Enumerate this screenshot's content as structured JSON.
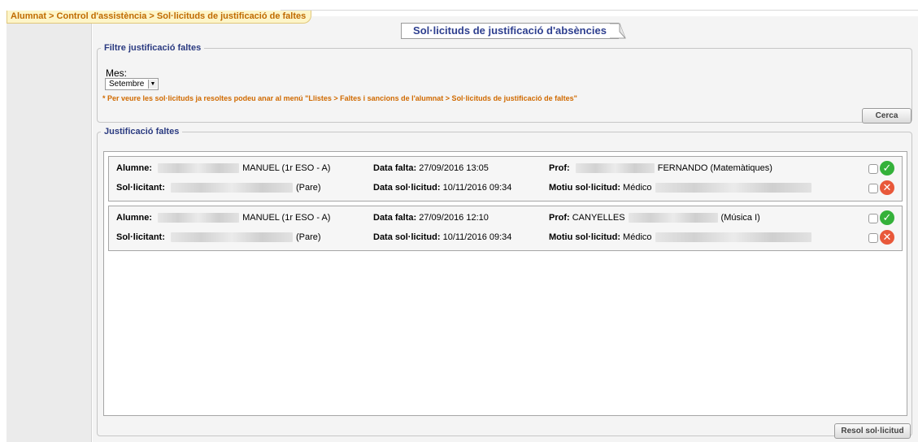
{
  "breadcrumb": "Alumnat > Control d'assistència > Sol·licituds de justificació de faltes",
  "page_title": "Sol·licituds de justificació d'absències",
  "filter": {
    "legend": "Filtre justificació faltes",
    "mes_label": "Mes:",
    "mes_value": "Setembre",
    "note": "* Per veure les sol·licituds ja resoltes podeu anar al menú \"Llistes > Faltes i sancions de l'alumnat > Sol·licituds de justificació de faltes\"",
    "search_button": "Cerca"
  },
  "justification": {
    "legend": "Justificació faltes",
    "resolve_button": "Resol sol·licitud",
    "labels": {
      "alumne": "Alumne:",
      "data_falta": "Data falta:",
      "prof": "Prof:",
      "sollicitant": "Sol·licitant:",
      "data_sollicitud": "Data sol·licitud:",
      "motiu": "Motiu sol·licitud:"
    },
    "requests": [
      {
        "alumne": "MANUEL (1r ESO - A)",
        "data_falta": "27/09/2016 13:05",
        "prof_prefix": "",
        "prof_suffix": "FERNANDO (Matemàtiques)",
        "sollicitant": "(Pare)",
        "data_sollicitud": "10/11/2016 09:34",
        "motiu": "Médico"
      },
      {
        "alumne": "MANUEL (1r ESO - A)",
        "data_falta": "27/09/2016 12:10",
        "prof_prefix": "CANYELLES",
        "prof_suffix": "(Música I)",
        "sollicitant": "(Pare)",
        "data_sollicitud": "10/11/2016 09:34",
        "motiu": "Médico"
      }
    ]
  },
  "icons": {
    "accept": "check-circle-icon",
    "reject": "x-circle-icon"
  },
  "colors": {
    "breadcrumb_text": "#c06a00",
    "title_text": "#2e3f8f",
    "note_text": "#d06a00",
    "accept": "#34b13a",
    "reject": "#e8583a"
  }
}
